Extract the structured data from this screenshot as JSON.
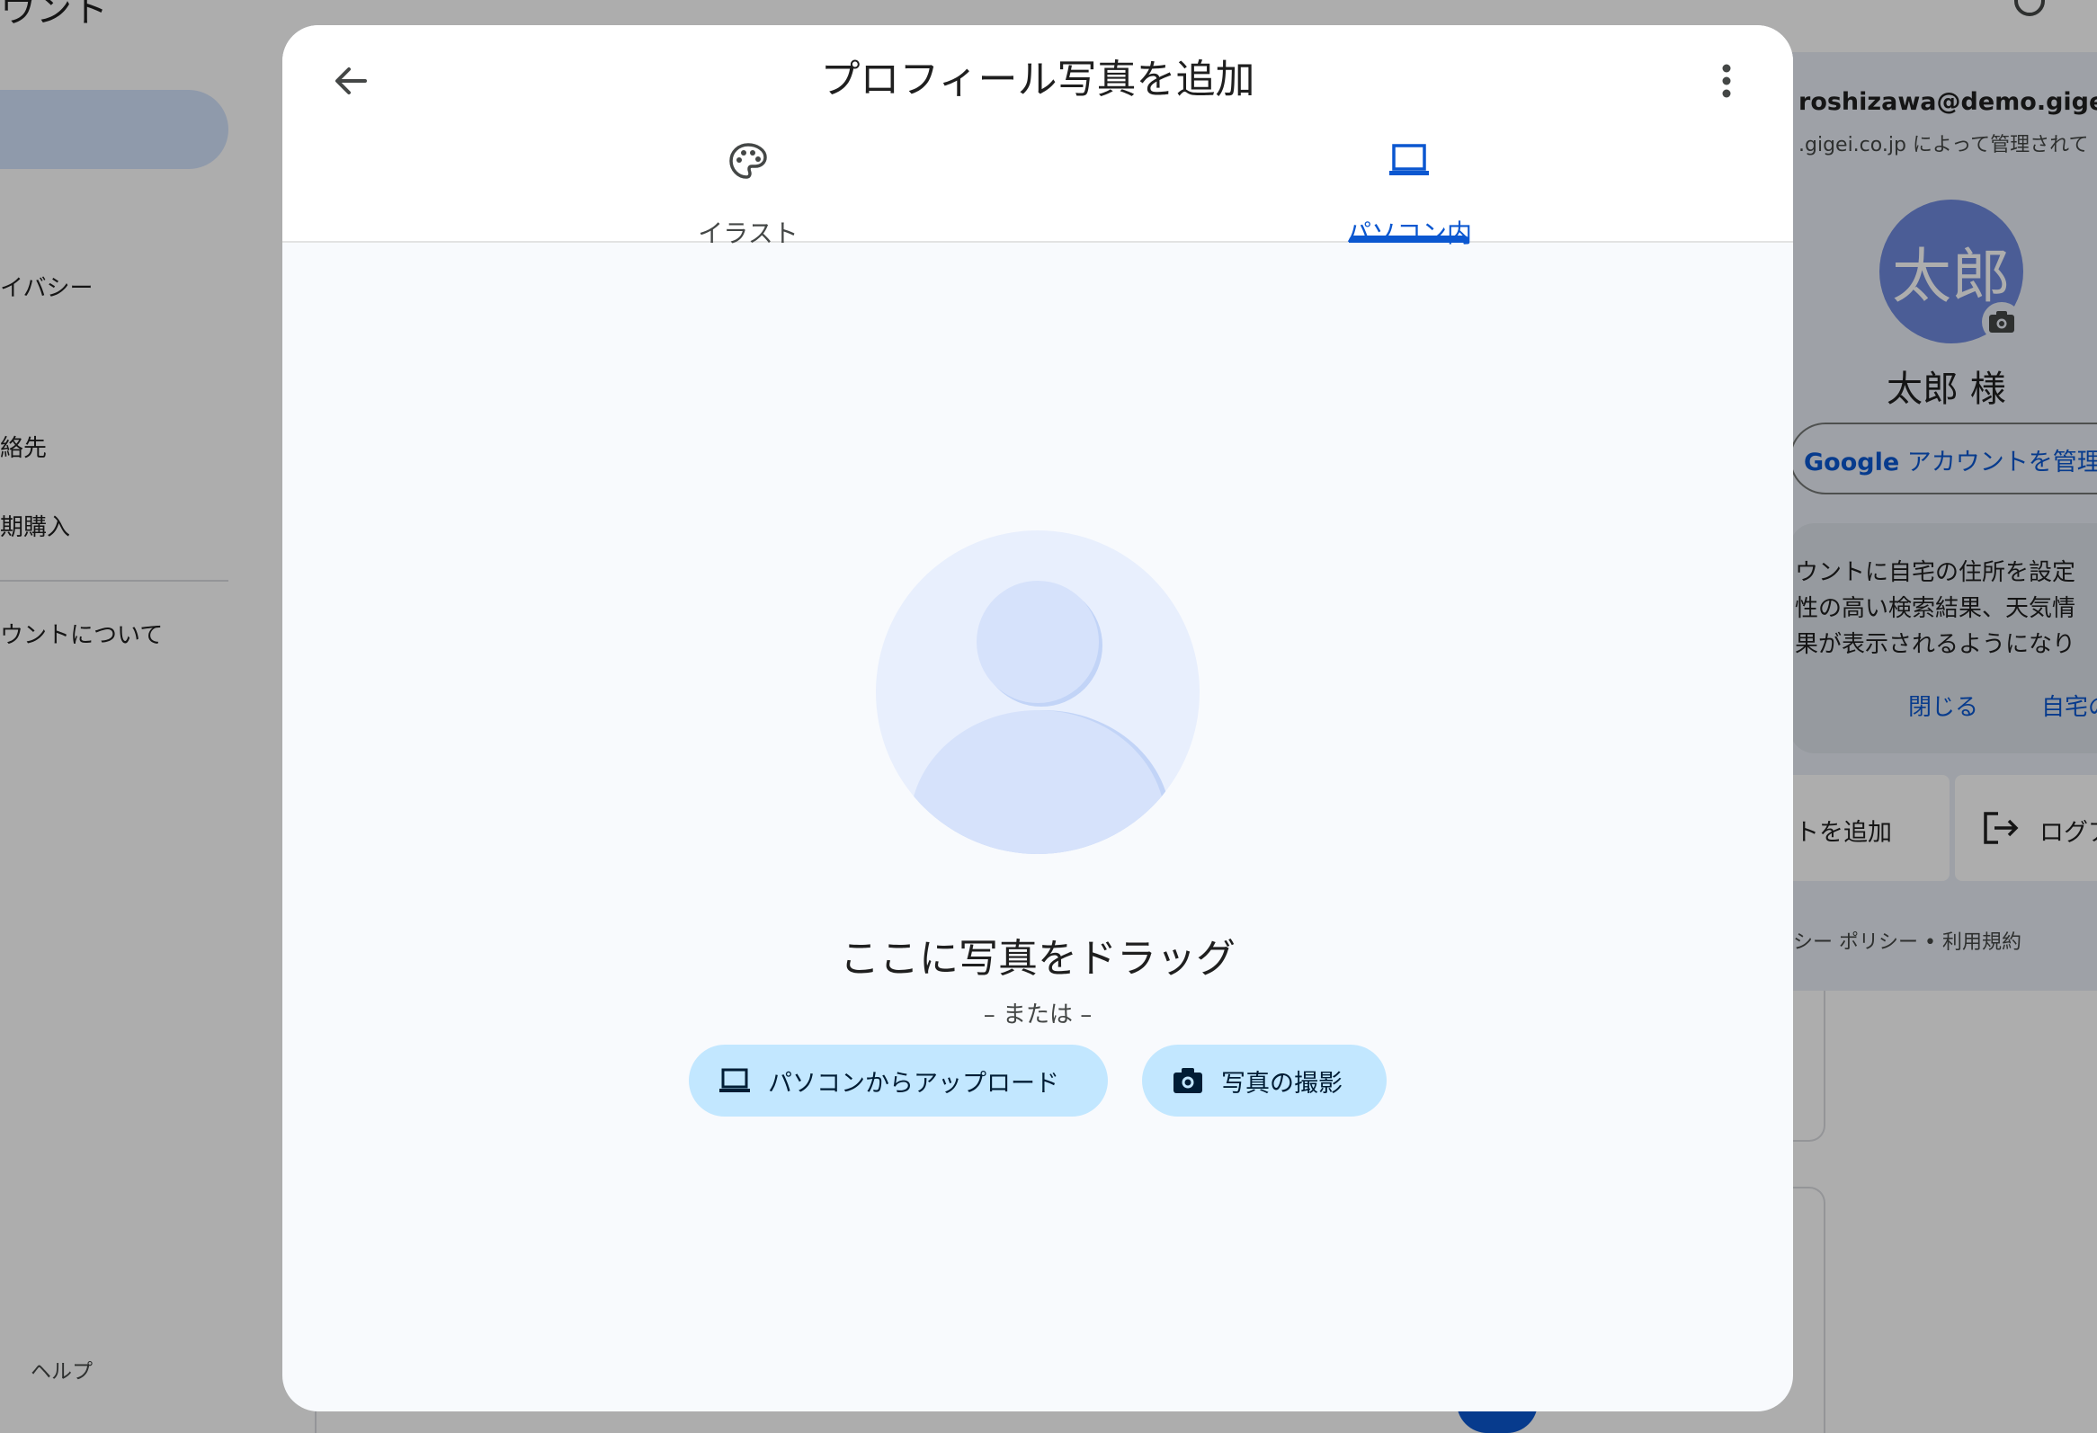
{
  "background": {
    "title": "ウント",
    "nav_items": [
      "イバシー",
      "絡先",
      "期購入",
      "ウントについて"
    ],
    "help": "ヘルプ"
  },
  "account_popup": {
    "email": "roshizawa@demo.gigei.co.",
    "managed_by": ".gigei.co.jp によって管理されて",
    "avatar_initials": "太郎",
    "name": "太郎 様",
    "manage_button_brand": "Google",
    "manage_button_text": "アカウントを管理",
    "info_lines": [
      "ウントに自宅の住所を設定",
      "性の高い検索結果、天気情",
      "果が表示されるようになり"
    ],
    "info_close": "閉じる",
    "info_action": "自宅の",
    "add_account": "トを追加",
    "logout": "ログア",
    "footer": "シー ポリシー  •  利用規約"
  },
  "dialog": {
    "title": "プロフィール写真を追加",
    "tabs": [
      {
        "label": "イラスト",
        "icon": "palette-icon",
        "selected": false
      },
      {
        "label": "パソコン内",
        "icon": "laptop-icon",
        "selected": true
      }
    ],
    "drag_title": "ここに写真をドラッグ",
    "or_text": "– または –",
    "upload_button": "パソコンからアップロード",
    "camera_button": "写真の撮影"
  },
  "colors": {
    "accent": "#0b57d0",
    "pill": "#c2e7ff",
    "surface": "#f8fafd",
    "avatar": "#6f89de"
  }
}
